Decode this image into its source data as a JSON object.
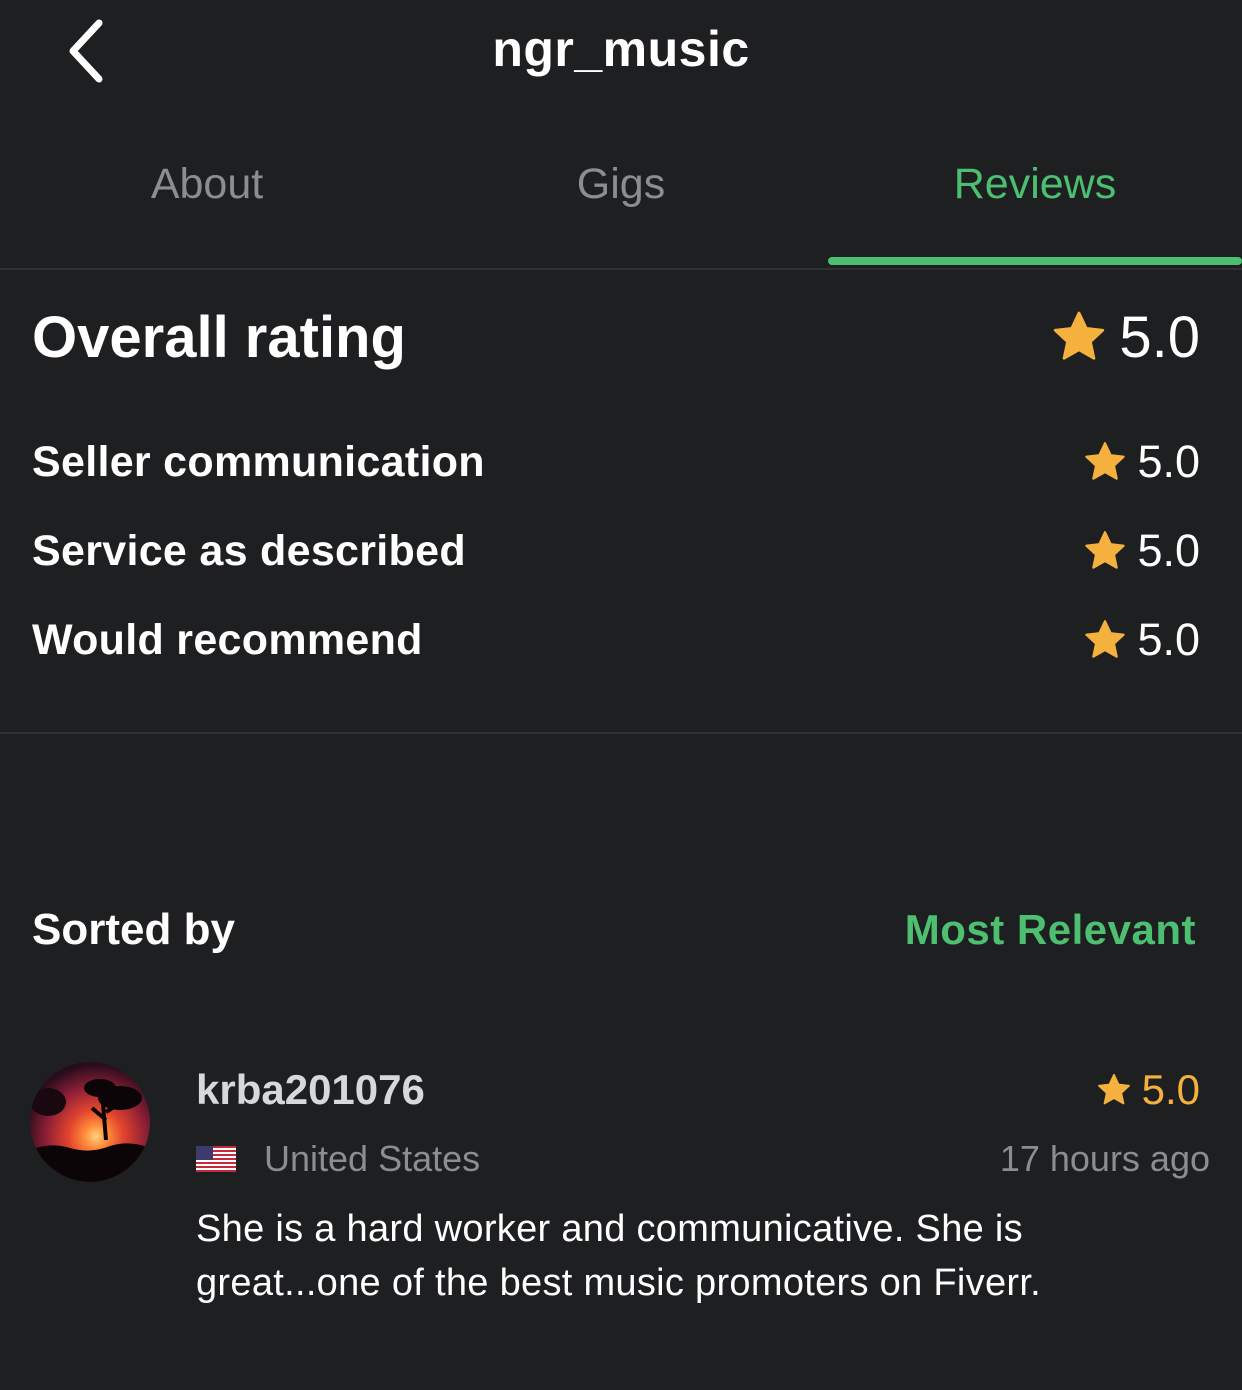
{
  "header": {
    "title": "ngr_music",
    "back_icon": "chevron-left-icon"
  },
  "tabs": [
    {
      "label": "About",
      "active": false
    },
    {
      "label": "Gigs",
      "active": false
    },
    {
      "label": "Reviews",
      "active": true
    }
  ],
  "ratings": {
    "overall_label": "Overall rating",
    "overall_value": "5.0",
    "items": [
      {
        "label": "Seller communication",
        "value": "5.0"
      },
      {
        "label": "Service as described",
        "value": "5.0"
      },
      {
        "label": "Would recommend",
        "value": "5.0"
      }
    ],
    "star_icon": "star-icon"
  },
  "sort": {
    "label": "Sorted by",
    "value": "Most Relevant"
  },
  "review": {
    "username": "krba201076",
    "score": "5.0",
    "country": "United States",
    "time": "17 hours ago",
    "text": "She is a hard worker and communicative. She is great...one of the best music promoters on Fiverr."
  },
  "colors": {
    "background": "#1e1f21",
    "accent_green": "#4dbf70",
    "star_gold": "#f5b13d",
    "muted_text": "#8b8d91"
  }
}
